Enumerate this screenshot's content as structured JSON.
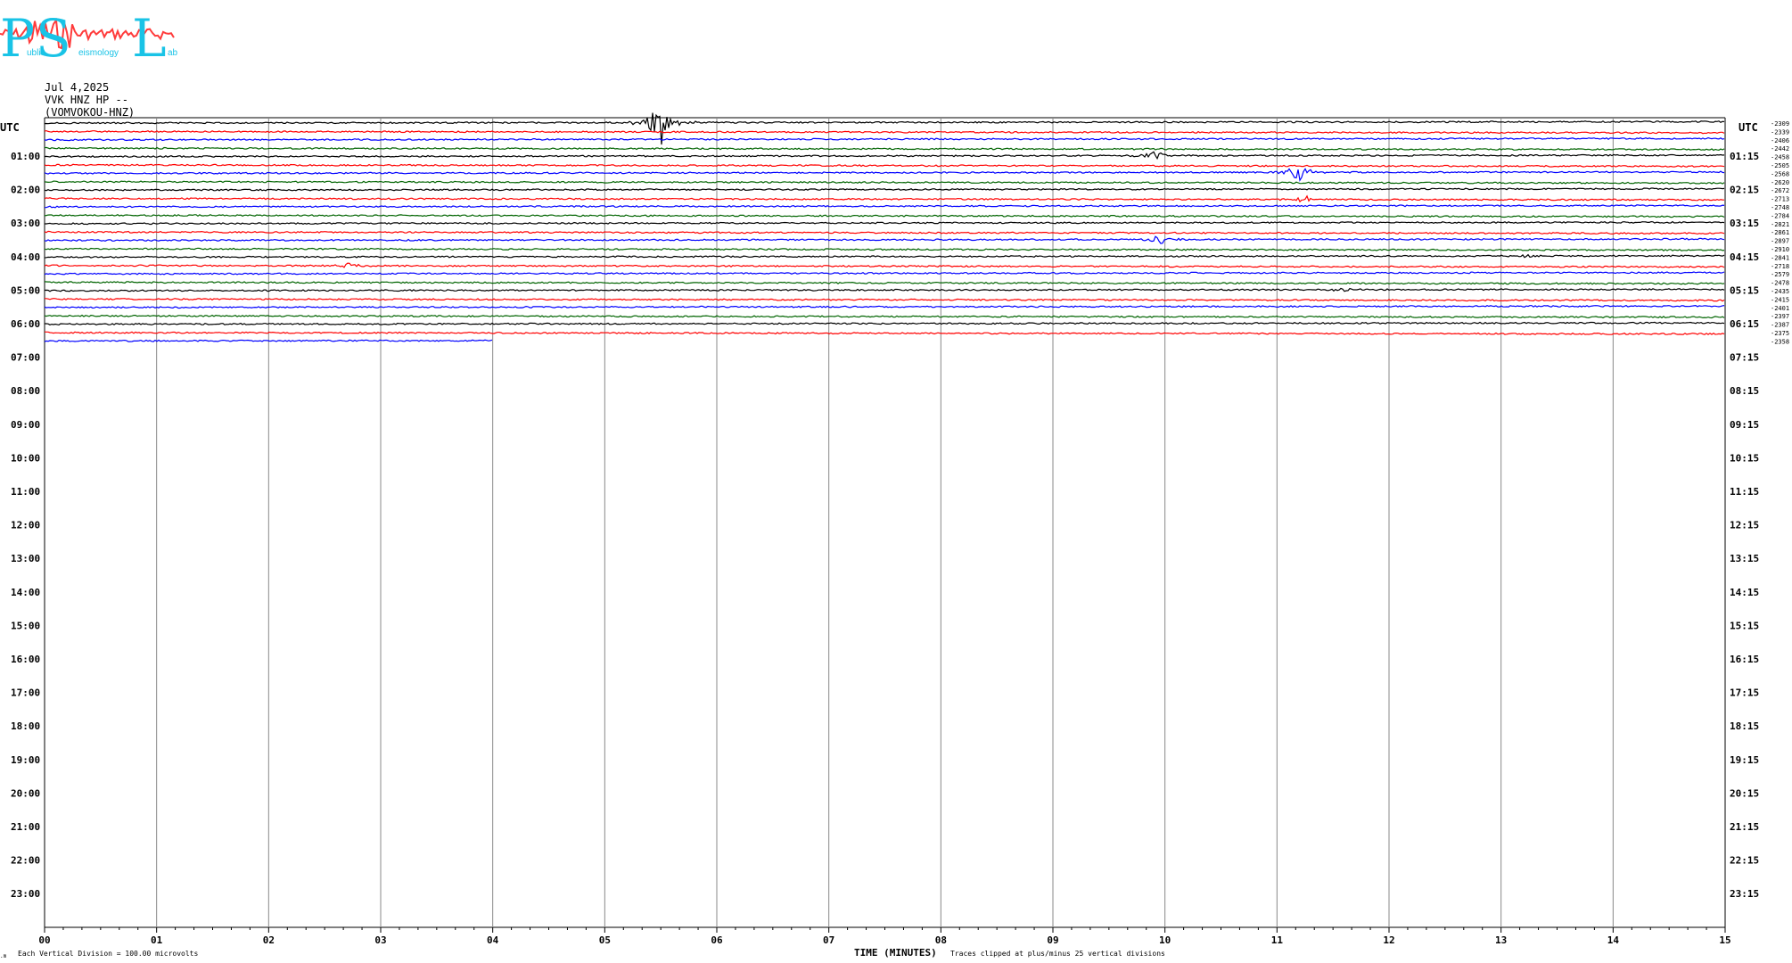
{
  "logo": {
    "big_letters": [
      "P",
      "S",
      "L"
    ],
    "small_words": [
      "ublic",
      "eismology",
      "ab"
    ],
    "colors": {
      "letters": "#19c3e6",
      "waveform": "#ff3b3b"
    }
  },
  "header": {
    "date": "Jul 4,2025",
    "station": "VVK HNZ HP --",
    "channel": "(VOMVOKOU-HNZ)"
  },
  "chart_data": {
    "type": "helicorder",
    "left_axis_label": "UTC",
    "right_axis_label": "UTC",
    "left_times": [
      "01:00",
      "02:00",
      "03:00",
      "04:00",
      "05:00",
      "06:00",
      "07:00",
      "08:00",
      "09:00",
      "10:00",
      "11:00",
      "12:00",
      "13:00",
      "14:00",
      "15:00",
      "16:00",
      "17:00",
      "18:00",
      "19:00",
      "20:00",
      "21:00",
      "22:00",
      "23:00"
    ],
    "right_times": [
      "01:15",
      "02:15",
      "03:15",
      "04:15",
      "05:15",
      "06:15",
      "07:15",
      "08:15",
      "09:15",
      "10:15",
      "11:15",
      "12:15",
      "13:15",
      "14:15",
      "15:15",
      "16:15",
      "17:15",
      "18:15",
      "19:15",
      "20:15",
      "21:15",
      "22:15",
      "23:15"
    ],
    "x_ticks": [
      "00",
      "01",
      "02",
      "03",
      "04",
      "05",
      "06",
      "07",
      "08",
      "09",
      "10",
      "11",
      "12",
      "13",
      "14",
      "15"
    ],
    "xlabel": "TIME (MINUTES)",
    "xlim": [
      0,
      15
    ],
    "minutes_per_line": 15,
    "trace_colors": [
      "#000000",
      "#ff0000",
      "#0000ff",
      "#006400"
    ],
    "trace_offsets": [
      "-2309",
      "-2339",
      "-2406",
      "-2442",
      "-2458",
      "-2505",
      "-2568",
      "-2620",
      "-2672",
      "-2713",
      "-2748",
      "-2784",
      "-2821",
      "-2861",
      "-2897",
      "-2910",
      "-2841",
      "-2718",
      "-2579",
      "-2478",
      "-2435",
      "-2415",
      "-2401",
      "-2397",
      "-2387",
      "-2375",
      "-2358"
    ],
    "traces_recorded": 27,
    "last_trace_end_minute": 4.0,
    "events": [
      {
        "trace": 0,
        "minute": 5.5,
        "amplitude": 1.0
      },
      {
        "trace": 4,
        "minute": 9.9,
        "amplitude": 0.2
      },
      {
        "trace": 6,
        "minute": 11.2,
        "amplitude": 0.35
      },
      {
        "trace": 9,
        "minute": 11.25,
        "amplitude": 0.15
      },
      {
        "trace": 14,
        "minute": 9.95,
        "amplitude": 0.2
      },
      {
        "trace": 16,
        "minute": 13.2,
        "amplitude": 0.1
      },
      {
        "trace": 17,
        "minute": 2.7,
        "amplitude": 0.15
      },
      {
        "trace": 20,
        "minute": 11.6,
        "amplitude": 0.1
      }
    ],
    "grid": true
  },
  "footer": {
    "scale_note": "Each Vertical Division =  100.00 microvolts",
    "clip_note": "Traces clipped at plus/minus 25 vertical divisions"
  }
}
